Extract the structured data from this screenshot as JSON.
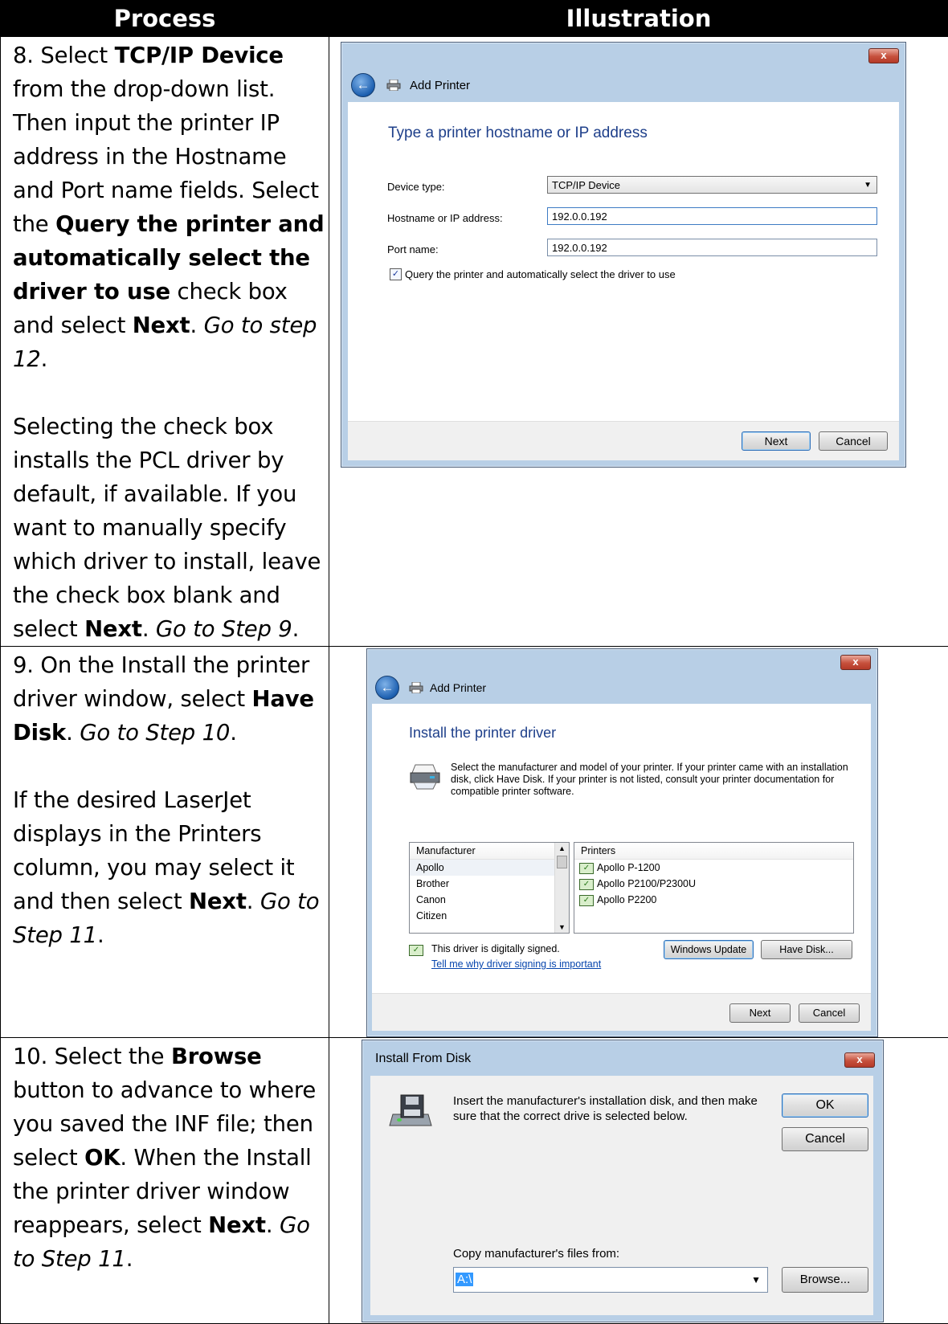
{
  "header": {
    "process": "Process",
    "illustration": "Illustration"
  },
  "step8": {
    "text": [
      [
        "t",
        "8. Select "
      ],
      [
        "b",
        "TCP/IP Device"
      ],
      [
        "t",
        " from the drop-down list. Then input the printer IP address in the Hostname and Port name fields. Select the "
      ],
      [
        "b",
        "Query the printer and automatically select the driver to use"
      ],
      [
        "t",
        " check box and select "
      ],
      [
        "b",
        "Next"
      ],
      [
        "t",
        ". "
      ],
      [
        "i",
        "Go to step 12"
      ],
      [
        "t",
        "."
      ]
    ],
    "text2": [
      [
        "t",
        "Selecting the check box installs the PCL driver by default, if available. If you want to manually specify which driver to install, leave the check box blank and select "
      ],
      [
        "b",
        "Next"
      ],
      [
        "t",
        ". "
      ],
      [
        "i",
        "Go to Step 9"
      ],
      [
        "t",
        "."
      ]
    ],
    "dialog": {
      "title": "Add Printer",
      "heading": "Type a printer hostname or IP address",
      "device_type_label": "Device type:",
      "device_type_value": "TCP/IP Device",
      "hostname_label": "Hostname or IP address:",
      "hostname_value": "192.0.0.192",
      "port_label": "Port name:",
      "port_value": "192.0.0.192",
      "query_checkbox_label": "Query the printer and automatically select the driver to use",
      "next": "Next",
      "cancel": "Cancel",
      "close": "x"
    }
  },
  "step9": {
    "text": [
      [
        "t",
        "9. On the Install the printer driver window, select "
      ],
      [
        "b",
        "Have Disk"
      ],
      [
        "t",
        ". "
      ],
      [
        "i",
        "Go to Step 10"
      ],
      [
        "t",
        "."
      ]
    ],
    "text2": [
      [
        "t",
        "If the desired LaserJet displays in the Printers column, you may select it and then select "
      ],
      [
        "b",
        "Next"
      ],
      [
        "t",
        ". "
      ],
      [
        "i",
        "Go to Step 11"
      ],
      [
        "t",
        "."
      ]
    ],
    "dialog": {
      "title": "Add Printer",
      "heading": "Install the printer driver",
      "description": "Select the manufacturer and model of your printer. If your printer came with an installation disk, click Have Disk. If your printer is not listed, consult your printer documentation for compatible printer software.",
      "manufacturer_header": "Manufacturer",
      "manufacturers": [
        "Apollo",
        "Brother",
        "Canon",
        "Citizen"
      ],
      "printers_header": "Printers",
      "printers": [
        "Apollo P-1200",
        "Apollo P2100/P2300U",
        "Apollo P2200"
      ],
      "signed_text": "This driver is digitally signed.",
      "signing_link": "Tell me why driver signing is important",
      "windows_update": "Windows Update",
      "have_disk": "Have Disk...",
      "next": "Next",
      "cancel": "Cancel",
      "close": "x"
    }
  },
  "step10": {
    "text": [
      [
        "t",
        "10. Select the "
      ],
      [
        "b",
        "Browse"
      ],
      [
        "t",
        " button to advance to where you saved the INF file; then select "
      ],
      [
        "b",
        "OK"
      ],
      [
        "t",
        ". When the Install the printer driver window reappears, select "
      ],
      [
        "b",
        "Next"
      ],
      [
        "t",
        ". "
      ],
      [
        "i",
        "Go to Step 11"
      ],
      [
        "t",
        "."
      ]
    ],
    "dialog": {
      "title": "Install From Disk",
      "message": "Insert the manufacturer's installation disk, and then make sure that the correct drive is selected below.",
      "ok": "OK",
      "cancel": "Cancel",
      "copy_label": "Copy manufacturer's files from:",
      "path_value": "A:\\",
      "browse": "Browse...",
      "close": "x"
    }
  },
  "colors": {
    "header_bg": "#000000",
    "heading_blue": "#1e3f8a",
    "dialog_frame": "#b8cfe6",
    "close_red": "#c6503c"
  }
}
